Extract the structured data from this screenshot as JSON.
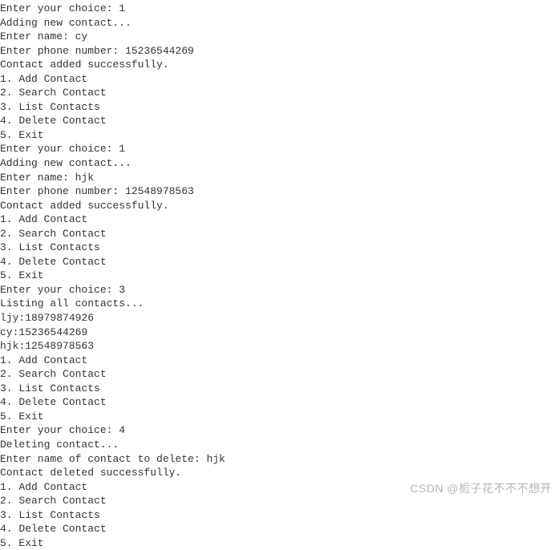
{
  "terminal": {
    "lines": [
      "Enter your choice: 1",
      "Adding new contact...",
      "Enter name: cy",
      "Enter phone number: 15236544269",
      "Contact added successfully.",
      "1. Add Contact",
      "2. Search Contact",
      "3. List Contacts",
      "4. Delete Contact",
      "5. Exit",
      "Enter your choice: 1",
      "Adding new contact...",
      "Enter name: hjk",
      "Enter phone number: 12548978563",
      "Contact added successfully.",
      "1. Add Contact",
      "2. Search Contact",
      "3. List Contacts",
      "4. Delete Contact",
      "5. Exit",
      "Enter your choice: 3",
      "Listing all contacts...",
      "ljy:18979874926",
      "cy:15236544269",
      "hjk:12548978563",
      "1. Add Contact",
      "2. Search Contact",
      "3. List Contacts",
      "4. Delete Contact",
      "5. Exit",
      "Enter your choice: 4",
      "Deleting contact...",
      "Enter name of contact to delete: hjk",
      "Contact deleted successfully.",
      "1. Add Contact",
      "2. Search Contact",
      "3. List Contacts",
      "4. Delete Contact",
      "5. Exit"
    ]
  },
  "watermark": {
    "text": "CSDN @栀子花不不不想开"
  }
}
